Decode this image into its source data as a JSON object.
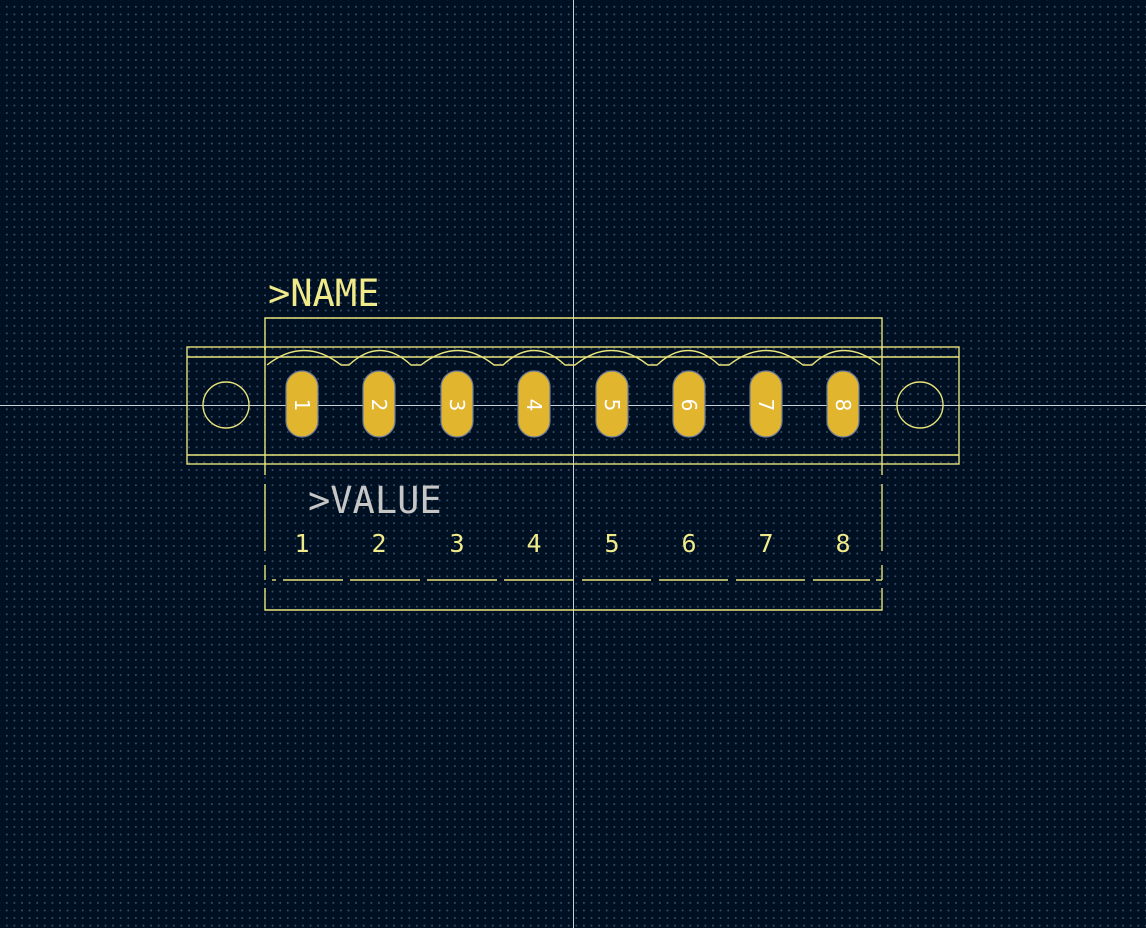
{
  "footprint": {
    "reference_label": ">NAME",
    "value_label": ">VALUE",
    "pads": [
      "1",
      "2",
      "3",
      "4",
      "5",
      "6",
      "7",
      "8"
    ],
    "pin_labels": [
      "1",
      "2",
      "3",
      "4",
      "5",
      "6",
      "7",
      "8"
    ]
  },
  "colors": {
    "background": "#001023",
    "silkscreen": "#e8e27a",
    "pad": "#e2b52f",
    "value_text": "#c6c6c6",
    "axis": "#c9d0d8"
  }
}
